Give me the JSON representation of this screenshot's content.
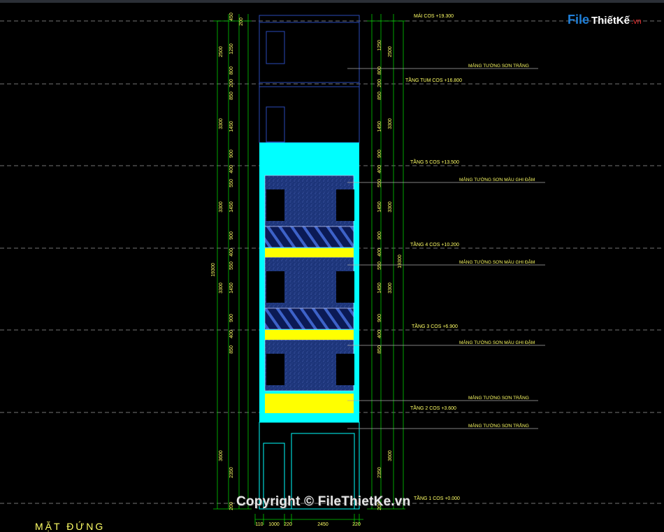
{
  "watermark": {
    "logo_file": "File",
    "logo_thiet_ke": "ThiếtKế",
    "logo_vn": ".vn",
    "copyright": "Copyright © FileThietKe.vn"
  },
  "drawing_title": "MẶT ĐỨNG",
  "levels": [
    {
      "label": "MÁI COS +19.300"
    },
    {
      "label": "TẦNG TUM COS +16.800"
    },
    {
      "label": "TẦNG 5 COS +13.500"
    },
    {
      "label": "TẦNG 4 COS +10.200"
    },
    {
      "label": "TẦNG 3 COS +6.900"
    },
    {
      "label": "TẦNG 2 COS +3.600"
    },
    {
      "label": "TẦNG 1 COS +0.000"
    }
  ],
  "callouts": [
    "MẢNG TƯỜNG SƠN TRẮNG",
    "MẢNG TƯỜNG SƠN MÀU GHI ĐẬM",
    "MẢNG TƯỜNG SƠN MÀU GHI ĐẬM",
    "MẢNG TƯỜNG SƠN MÀU GHI ĐẬM",
    "MẢNG TƯỜNG SƠN TRẮNG",
    "MẢNG TƯỜNG SƠN TRẮNG"
  ],
  "dims_left": [
    "450",
    "200",
    "2500",
    "1250",
    "800",
    "200",
    "850",
    "3300",
    "1450",
    "900",
    "400",
    "550",
    "3300",
    "1450",
    "900",
    "400",
    "550",
    "3300",
    "1450",
    "900",
    "400",
    "850",
    "3600",
    "2350",
    "200"
  ],
  "dims_left_total": "19300",
  "dims_right": [
    "2500",
    "1250",
    "800",
    "200",
    "850",
    "3300",
    "1450",
    "900",
    "400",
    "550",
    "3300",
    "1450",
    "900",
    "400",
    "550",
    "3300",
    "1450",
    "900",
    "400",
    "850",
    "3600",
    "2350",
    "200"
  ],
  "dims_right_total": "19300",
  "dims_bottom": [
    "110",
    "1000",
    "220",
    "2450",
    "220"
  ],
  "colors": {
    "background": "#000000",
    "cyan": "#00ffff",
    "yellow": "#ffff00",
    "dark_panel": "#1a2f6e",
    "dim_green": "#00ff00",
    "text_yellow": "#ffff66"
  }
}
